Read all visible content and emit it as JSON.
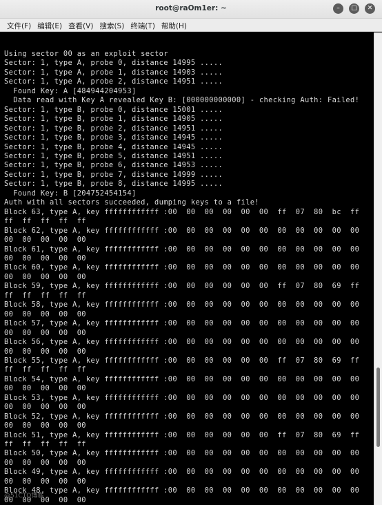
{
  "window": {
    "title": "root@raOm1er: ~"
  },
  "menu": [
    "文件(F)",
    "编辑(E)",
    "查看(V)",
    "搜索(S)",
    "终端(T)",
    "帮助(H)"
  ],
  "terminal": {
    "lines": [
      "Using sector 00 as an exploit sector",
      "Sector: 1, type A, probe 0, distance 14995 .....",
      "Sector: 1, type A, probe 1, distance 14903 .....",
      "Sector: 1, type A, probe 2, distance 14951 .....",
      "  Found Key: A [484944204953]",
      "  Data read with Key A revealed Key B: [000000000000] - checking Auth: Failed!",
      "Sector: 1, type B, probe 0, distance 15001 .....",
      "Sector: 1, type B, probe 1, distance 14905 .....",
      "Sector: 1, type B, probe 2, distance 14951 .....",
      "Sector: 1, type B, probe 3, distance 14945 .....",
      "Sector: 1, type B, probe 4, distance 14945 .....",
      "Sector: 1, type B, probe 5, distance 14951 .....",
      "Sector: 1, type B, probe 6, distance 14953 .....",
      "Sector: 1, type B, probe 7, distance 14999 .....",
      "Sector: 1, type B, probe 8, distance 14995 .....",
      "  Found Key: B [204752454154]",
      "Auth with all sectors succeeded, dumping keys to a file!",
      "Block 63, type A, key ffffffffffff :00  00  00  00  00  00  ff  07  80  bc  ff",
      "ff  ff  ff  ff  ff",
      "Block 62, type A, key ffffffffffff :00  00  00  00  00  00  00  00  00  00  00",
      "00  00  00  00  00",
      "Block 61, type A, key ffffffffffff :00  00  00  00  00  00  00  00  00  00  00",
      "00  00  00  00  00",
      "Block 60, type A, key ffffffffffff :00  00  00  00  00  00  00  00  00  00  00",
      "00  00  00  00  00",
      "Block 59, type A, key ffffffffffff :00  00  00  00  00  00  ff  07  80  69  ff",
      "ff  ff  ff  ff  ff",
      "Block 58, type A, key ffffffffffff :00  00  00  00  00  00  00  00  00  00  00",
      "00  00  00  00  00",
      "Block 57, type A, key ffffffffffff :00  00  00  00  00  00  00  00  00  00  00",
      "00  00  00  00  00",
      "Block 56, type A, key ffffffffffff :00  00  00  00  00  00  00  00  00  00  00",
      "00  00  00  00  00",
      "Block 55, type A, key ffffffffffff :00  00  00  00  00  00  ff  07  80  69  ff",
      "ff  ff  ff  ff  ff",
      "Block 54, type A, key ffffffffffff :00  00  00  00  00  00  00  00  00  00  00",
      "00  00  00  00  00",
      "Block 53, type A, key ffffffffffff :00  00  00  00  00  00  00  00  00  00  00",
      "00  00  00  00  00",
      "Block 52, type A, key ffffffffffff :00  00  00  00  00  00  00  00  00  00  00",
      "00  00  00  00  00",
      "Block 51, type A, key ffffffffffff :00  00  00  00  00  00  ff  07  80  69  ff",
      "ff  ff  ff  ff  ff",
      "Block 50, type A, key ffffffffffff :00  00  00  00  00  00  00  00  00  00  00",
      "00  00  00  00  00",
      "Block 49, type A, key ffffffffffff :00  00  00  00  00  00  00  00  00  00  00",
      "00  00  00  00  00",
      "Block 48, type A, key ffffffffffff :00  00  00  00  00  00  00  00  00  00  00",
      "00  00  00  00  00"
    ]
  },
  "watermark": "@51CTO博客"
}
